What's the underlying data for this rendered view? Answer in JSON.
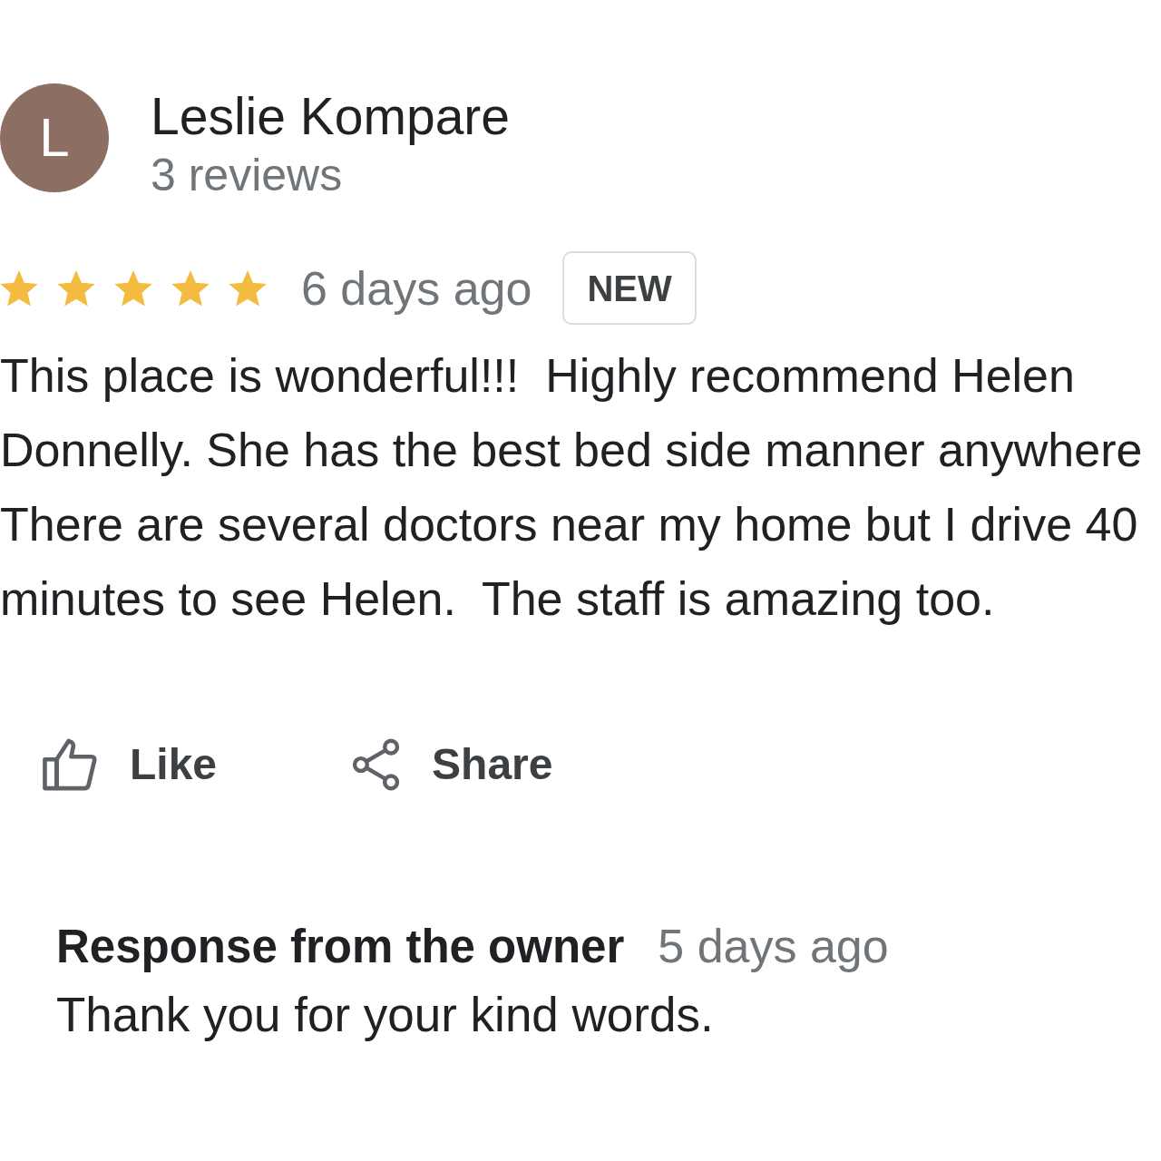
{
  "reviewer": {
    "initial": "L",
    "name": "Leslie Kompare",
    "review_count": "3 reviews"
  },
  "review": {
    "stars": 5,
    "time": "6 days ago",
    "badge": "NEW",
    "lines": [
      "This place is wonderful!!!  Highly recommend Helen",
      "Donnelly. She has the best bed side manner anywhere",
      "There are several doctors near my home but I drive 40",
      "minutes to see Helen.  The staff is amazing too."
    ]
  },
  "actions": [
    {
      "kind": "like",
      "label": "Like"
    },
    {
      "kind": "share",
      "label": "Share"
    }
  ],
  "owner_response": {
    "heading": "Response from the owner",
    "time": "5 days ago",
    "text": "Thank you for your kind words."
  }
}
